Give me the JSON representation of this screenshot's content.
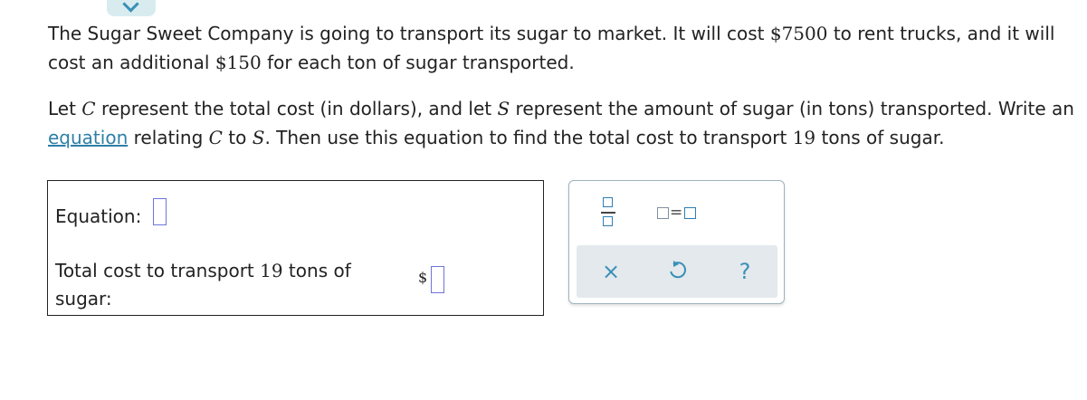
{
  "problem": {
    "p1": {
      "part1": "The Sugar Sweet Company is going to transport its sugar to market. It will cost ",
      "amount_trucks": "$7500",
      "part2": " to rent trucks, and it will cost an additional ",
      "amount_per_ton": "$150",
      "part3": " for each ton of sugar transported."
    },
    "p2": {
      "part1": "Let ",
      "var_c": "C",
      "part2": " represent the total cost (in dollars), and let ",
      "var_s": "S",
      "part3": " represent the amount of sugar (in tons) transported. Write an ",
      "link": "equation",
      "part4": " relating ",
      "var_c2": "C",
      "part5": " to ",
      "var_s2": "S",
      "part6": ". Then use this equation to find the total cost to transport ",
      "tons": "19",
      "part7": " tons of sugar."
    }
  },
  "answer": {
    "equation_label": "Equation:",
    "cost_label_part1": "Total cost to transport ",
    "cost_tons": "19",
    "cost_label_part2": " tons of",
    "cost_label_part3": "sugar:",
    "dollar_sign": "$"
  },
  "keypad": {
    "equals_symbol": "=",
    "clear_symbol": "×",
    "help_symbol": "?",
    "icons": [
      "fraction-icon",
      "equation-template-icon",
      "clear-icon",
      "undo-icon",
      "help-icon"
    ],
    "accent_color": "#3a8fb7"
  }
}
